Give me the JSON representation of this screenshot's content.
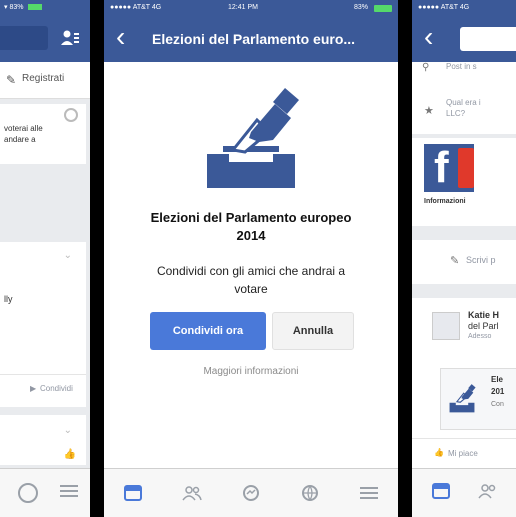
{
  "left_phone": {
    "status": "▾ 83%",
    "header_action": "Registrati",
    "snippet_line1": "voterai alle",
    "snippet_line2": "andare a",
    "snippet_fragment": "lly",
    "share_link": "Condividi"
  },
  "center_phone": {
    "status": {
      "carrier": "●●●●● AT&T  4G",
      "time": "12:41 PM",
      "battery": "83%"
    },
    "nav_title": "Elezioni del Parlamento euro...",
    "dialog": {
      "title_line1": "Elezioni del Parlamento europeo",
      "title_line2": "2014",
      "subtitle_line1": "Condividi con gli amici che andrai a",
      "subtitle_line2": "votare",
      "primary_button": "Condividi ora",
      "secondary_button": "Annulla",
      "more_link": "Maggiori informazioni"
    },
    "icons": [
      "news-feed-icon",
      "friends-icon",
      "messages-icon",
      "notifications-icon",
      "more-icon"
    ]
  },
  "right_phone": {
    "status": "●●●●● AT&T  4G",
    "row1": "Post in s",
    "row2_line1": "Qual era i",
    "row2_line2": "LLC?",
    "page_tab": "Informazioni",
    "write_post": "Scrivi p",
    "author_line1": "Katie H",
    "author_line2": "del Parl",
    "author_line3": "Adesso",
    "attachment_line1": "Ele",
    "attachment_line2": "201",
    "attachment_line3": "Con",
    "like": "Mi piace"
  },
  "colors": {
    "facebook_blue": "#3b5998",
    "button_blue": "#4a79d9",
    "page_red": "#e0392b"
  }
}
